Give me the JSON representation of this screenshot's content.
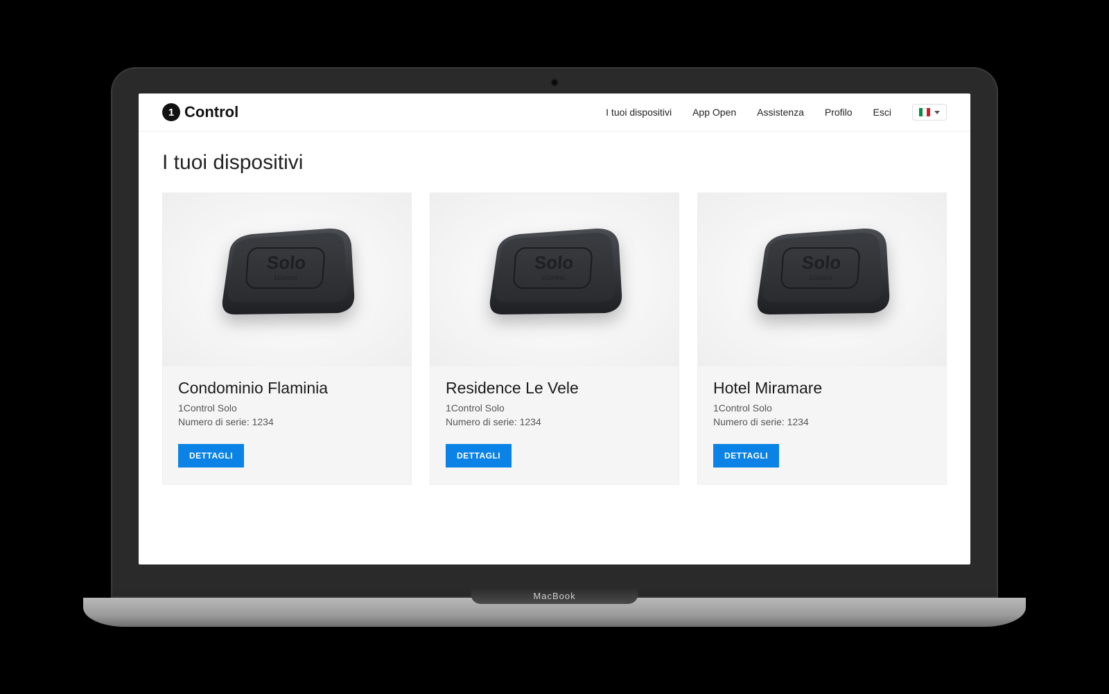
{
  "brand": {
    "mark": "1",
    "name": "Control"
  },
  "nav": {
    "items": [
      {
        "label": "I tuoi dispositivi"
      },
      {
        "label": "App Open"
      },
      {
        "label": "Assistenza"
      },
      {
        "label": "Profilo"
      },
      {
        "label": "Esci"
      }
    ],
    "language": "it"
  },
  "page": {
    "title": "I tuoi dispositivi",
    "detailsLabel": "DETTAGLI",
    "serialLabel": "Numero di serie:"
  },
  "devices": [
    {
      "name": "Condominio Flaminia",
      "model": "1Control Solo",
      "serial": "1234"
    },
    {
      "name": "Residence Le Vele",
      "model": "1Control Solo",
      "serial": "1234"
    },
    {
      "name": "Hotel Miramare",
      "model": "1Control Solo",
      "serial": "1234"
    }
  ],
  "mockup": {
    "base_label": "MacBook"
  }
}
